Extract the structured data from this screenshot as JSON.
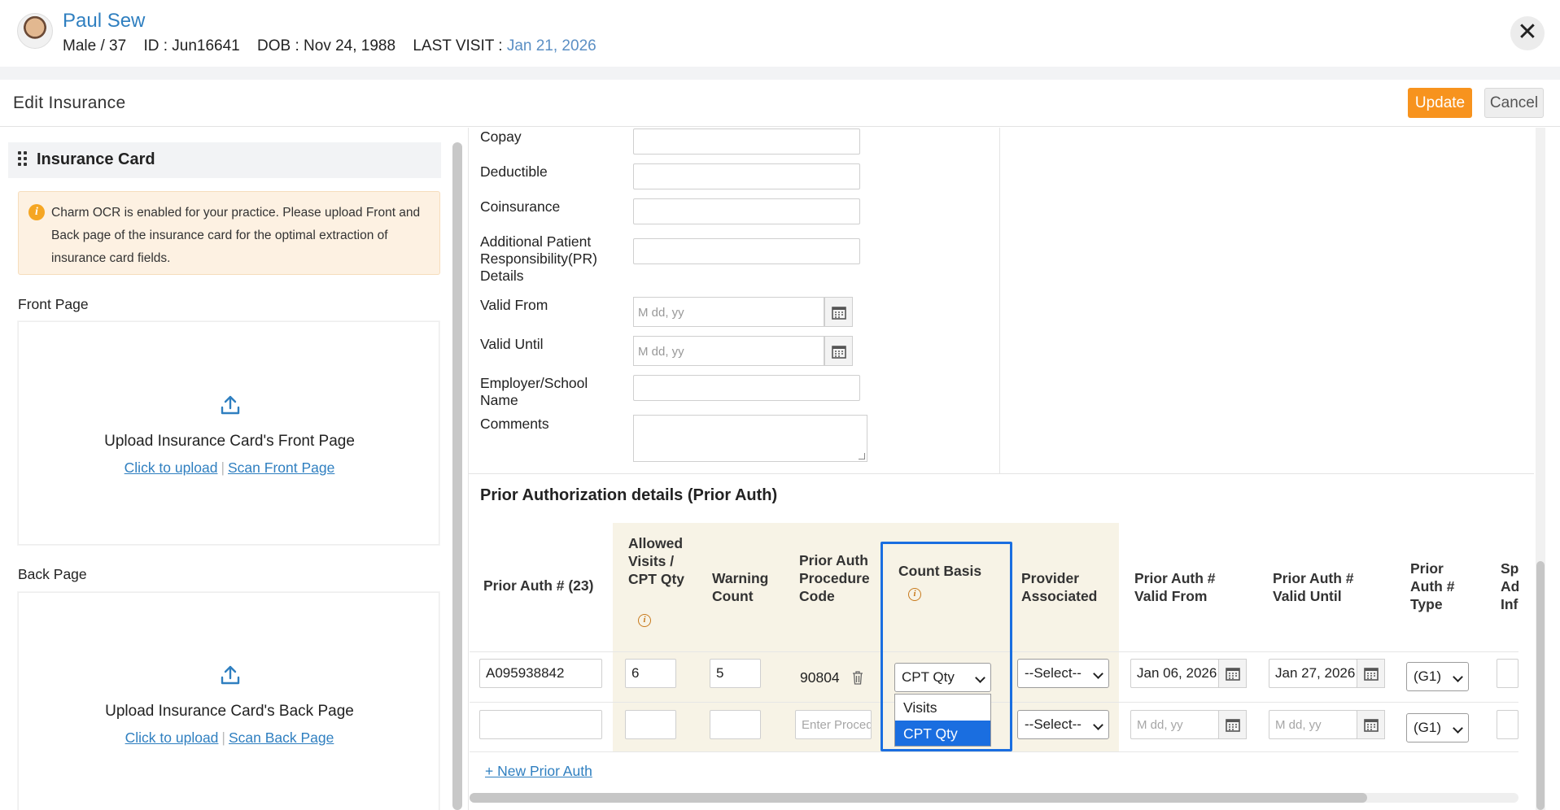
{
  "patient": {
    "name": "Paul Sew",
    "gender_age": "Male / 37",
    "id": "ID : Jun16641",
    "dob": "DOB : Nov 24, 1988",
    "last_visit_label": "LAST VISIT :",
    "last_visit_value": "Jan 21, 2026"
  },
  "window": {
    "title": "Edit Insurance",
    "update_label": "Update",
    "cancel_label": "Cancel",
    "close_glyph": "✕"
  },
  "insurance_card": {
    "title": "Insurance Card",
    "ocr_note": "Charm OCR is enabled for your practice. Please upload Front and Back page of the insurance card for the optimal extraction of insurance card fields.",
    "front": {
      "label": "Front Page",
      "upload_title": "Upload Insurance Card's Front Page",
      "click_upload": "Click to upload",
      "scan_link": "Scan Front Page"
    },
    "back": {
      "label": "Back Page",
      "upload_title": "Upload Insurance Card's Back Page",
      "click_upload": "Click to upload",
      "scan_link": "Scan Back Page"
    }
  },
  "form": {
    "copay": "Copay",
    "deductible": "Deductible",
    "coinsurance": "Coinsurance",
    "additional_pr": "Additional Patient Responsibility(PR) Details",
    "valid_from": "Valid From",
    "valid_until": "Valid Until",
    "date_placeholder": "M dd, yy",
    "employer": "Employer/School Name",
    "comments": "Comments"
  },
  "prior_auth": {
    "title": "Prior Authorization details (Prior Auth)",
    "columns": {
      "auth_no": "Prior Auth # (23)",
      "allowed": "Allowed Visits / CPT Qty",
      "warning": "Warning Count",
      "proc_code": "Prior Auth Procedure Code",
      "count_basis": "Count Basis",
      "provider": "Provider Associated",
      "valid_from": "Prior Auth # Valid From",
      "valid_until": "Prior Auth # Valid Until",
      "type": "Prior Auth # Type",
      "special": "Sp Ad Inf"
    },
    "rows": [
      {
        "auth_no": "A095938842",
        "allowed": "6",
        "warning": "5",
        "proc_code": "90804",
        "count_basis": "CPT Qty",
        "provider": "--Select--",
        "valid_from": "Jan 06, 2026",
        "valid_until": "Jan 27, 2026",
        "type": "(G1)"
      },
      {
        "auth_no": "",
        "allowed": "",
        "warning": "",
        "proc_code_placeholder": "Enter Procedure Code",
        "provider": "--Select--",
        "date_placeholder": "M dd, yy",
        "type": "(G1)"
      }
    ],
    "dropdown_options": [
      "Visits",
      "CPT Qty"
    ],
    "new_link": "+ New Prior Auth"
  },
  "colors": {
    "brand_blue": "#2f7fc0",
    "update_orange": "#f7931e",
    "highlight_blue": "#1a6ee0",
    "beige": "#f7f3e6"
  },
  "icons": [
    "close-icon",
    "drag-handle-icon",
    "info-icon",
    "upload-icon",
    "calendar-icon",
    "trash-icon",
    "chevron-down-icon"
  ]
}
